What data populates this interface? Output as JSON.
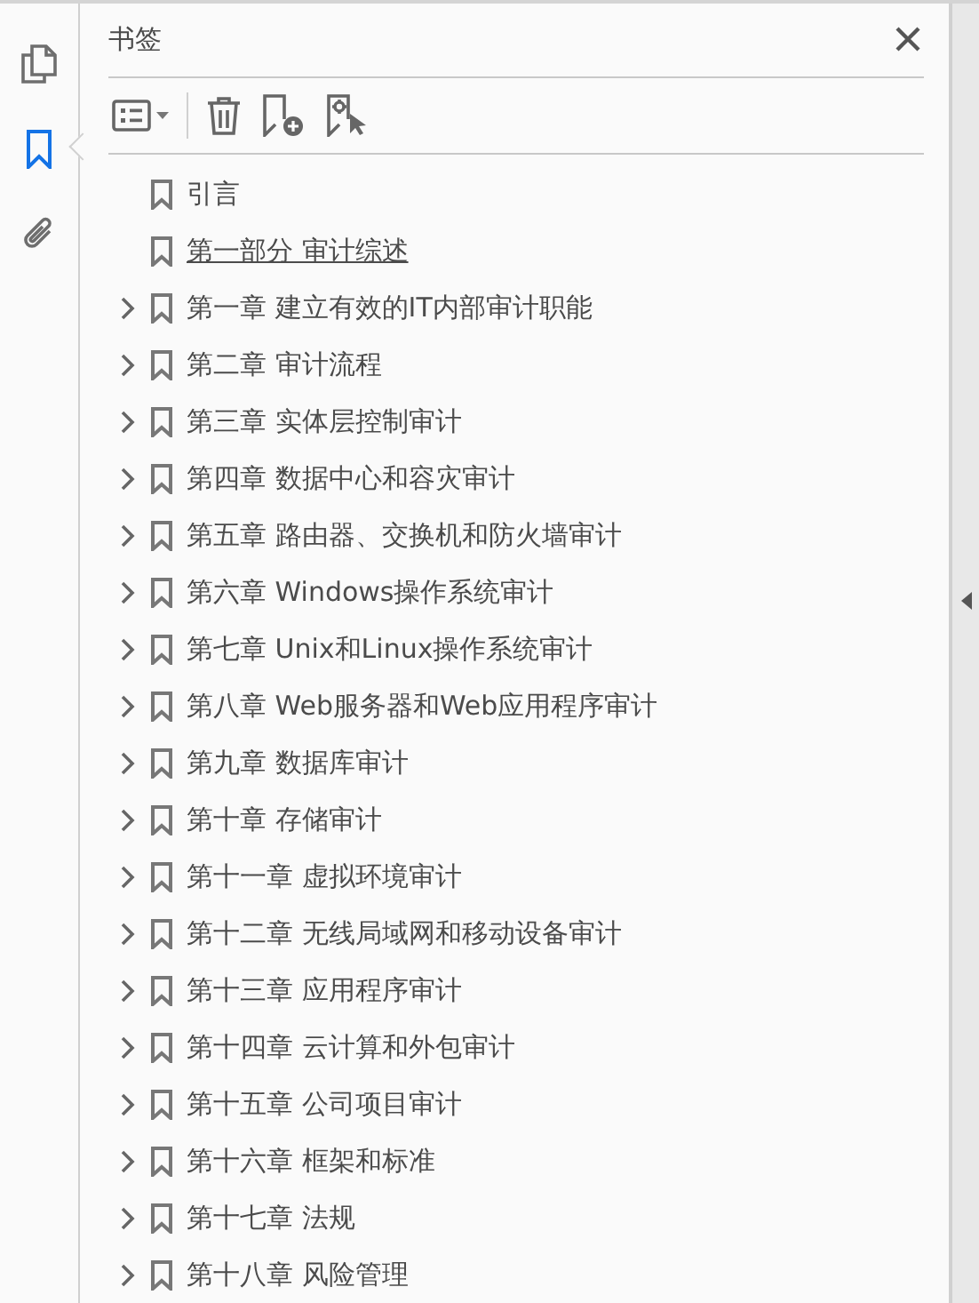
{
  "rail_tabs": [
    {
      "selected": false
    },
    {
      "selected": true
    },
    {
      "selected": false
    }
  ],
  "panel": {
    "title": "书签"
  },
  "bookmarks": [
    {
      "label": "引言",
      "expandable": false,
      "hovered": false
    },
    {
      "label": "第一部分  审计综述",
      "expandable": false,
      "hovered": true
    },
    {
      "label": "第一章  建立有效的IT内部审计职能",
      "expandable": true,
      "hovered": false
    },
    {
      "label": "第二章  审计流程",
      "expandable": true,
      "hovered": false
    },
    {
      "label": "第三章  实体层控制审计",
      "expandable": true,
      "hovered": false
    },
    {
      "label": "第四章  数据中心和容灾审计",
      "expandable": true,
      "hovered": false
    },
    {
      "label": "第五章  路由器、交换机和防火墙审计",
      "expandable": true,
      "hovered": false
    },
    {
      "label": "第六章  Windows操作系统审计",
      "expandable": true,
      "hovered": false
    },
    {
      "label": "第七章  Unix和Linux操作系统审计",
      "expandable": true,
      "hovered": false
    },
    {
      "label": "第八章  Web服务器和Web应用程序审计",
      "expandable": true,
      "hovered": false
    },
    {
      "label": "第九章  数据库审计",
      "expandable": true,
      "hovered": false
    },
    {
      "label": "第十章  存储审计",
      "expandable": true,
      "hovered": false
    },
    {
      "label": "第十一章  虚拟环境审计",
      "expandable": true,
      "hovered": false
    },
    {
      "label": "第十二章  无线局域网和移动设备审计",
      "expandable": true,
      "hovered": false
    },
    {
      "label": "第十三章  应用程序审计",
      "expandable": true,
      "hovered": false
    },
    {
      "label": "第十四章  云计算和外包审计",
      "expandable": true,
      "hovered": false
    },
    {
      "label": "第十五章  公司项目审计",
      "expandable": true,
      "hovered": false
    },
    {
      "label": "第十六章  框架和标准",
      "expandable": true,
      "hovered": false
    },
    {
      "label": "第十七章  法规",
      "expandable": true,
      "hovered": false
    },
    {
      "label": "第十八章  风险管理",
      "expandable": true,
      "hovered": false
    }
  ]
}
